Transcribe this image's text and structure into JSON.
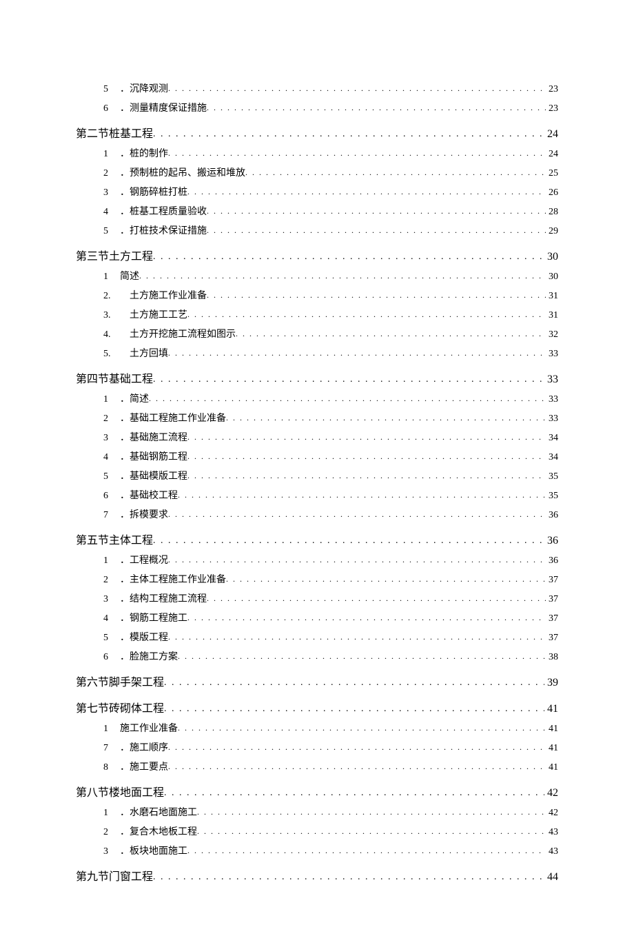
{
  "toc": [
    {
      "level": "sub",
      "num": "5",
      "label": "．沉降观测",
      "page": "23"
    },
    {
      "level": "sub",
      "num": "6",
      "label": "．测量精度保证措施",
      "page": "23"
    },
    {
      "level": "section",
      "num": "",
      "label": "第二节桩基工程",
      "page": "24"
    },
    {
      "level": "sub",
      "num": "1",
      "label": "．桩的制作",
      "page": "24"
    },
    {
      "level": "sub",
      "num": "2",
      "label": "．预制桩的起吊、搬运和堆放",
      "page": "25"
    },
    {
      "level": "sub",
      "num": "3",
      "label": "．钢筋碎桩打桩",
      "page": "26"
    },
    {
      "level": "sub",
      "num": "4",
      "label": "．桩基工程质量验收",
      "page": "28"
    },
    {
      "level": "sub",
      "num": "5",
      "label": "．打桩技术保证措施",
      "page": "29"
    },
    {
      "level": "section",
      "num": "",
      "label": "第三节土方工程",
      "page": "30"
    },
    {
      "level": "sub",
      "num": "1",
      "label": "简述",
      "page": "30"
    },
    {
      "level": "sub",
      "num": "2.",
      "label": "　土方施工作业准备",
      "page": "31"
    },
    {
      "level": "sub",
      "num": "3.",
      "label": "　土方施工工艺",
      "page": "31"
    },
    {
      "level": "sub",
      "num": "4.",
      "label": "　土方开挖施工流程如图示",
      "page": "32"
    },
    {
      "level": "sub",
      "num": "5.",
      "label": "　土方回填",
      "page": "33"
    },
    {
      "level": "section",
      "num": "",
      "label": "第四节基础工程",
      "page": "33"
    },
    {
      "level": "sub",
      "num": "1",
      "label": "．简述",
      "page": "33"
    },
    {
      "level": "sub",
      "num": "2",
      "label": "．基础工程施工作业准备",
      "page": "33"
    },
    {
      "level": "sub",
      "num": "3",
      "label": "．基础施工流程",
      "page": "34"
    },
    {
      "level": "sub",
      "num": "4",
      "label": "．基础钢筋工程",
      "page": "34"
    },
    {
      "level": "sub",
      "num": "5",
      "label": "．基础模版工程",
      "page": "35"
    },
    {
      "level": "sub",
      "num": "6",
      "label": "．基础校工程",
      "page": "35"
    },
    {
      "level": "sub",
      "num": "7",
      "label": "．拆模要求",
      "page": "36"
    },
    {
      "level": "section",
      "num": "",
      "label": "第五节主体工程",
      "page": "36"
    },
    {
      "level": "sub",
      "num": "1",
      "label": "．工程概况",
      "page": "36"
    },
    {
      "level": "sub",
      "num": "2",
      "label": "．主体工程施工作业准备",
      "page": "37"
    },
    {
      "level": "sub",
      "num": "3",
      "label": "．结构工程施工流程",
      "page": "37"
    },
    {
      "level": "sub",
      "num": "4",
      "label": "．钢筋工程施工",
      "page": "37"
    },
    {
      "level": "sub",
      "num": "5",
      "label": "．模版工程",
      "page": "37"
    },
    {
      "level": "sub",
      "num": "6",
      "label": "．脸施工方案",
      "page": "38"
    },
    {
      "level": "section",
      "num": "",
      "label": "第六节脚手架工程",
      "page": "39"
    },
    {
      "level": "section",
      "num": "",
      "label": "第七节砖砌体工程",
      "page": "41"
    },
    {
      "level": "sub",
      "num": "1",
      "label": "施工作业准备",
      "page": "41"
    },
    {
      "level": "sub",
      "num": "7",
      "label": "．施工顺序",
      "page": "41"
    },
    {
      "level": "sub",
      "num": "8",
      "label": "．施工要点",
      "page": "41"
    },
    {
      "level": "section",
      "num": "",
      "label": "第八节楼地面工程",
      "page": "42"
    },
    {
      "level": "sub",
      "num": "1",
      "label": "．水磨石地面施工",
      "page": "42"
    },
    {
      "level": "sub",
      "num": "2",
      "label": "．复合木地板工程",
      "page": "43"
    },
    {
      "level": "sub",
      "num": "3",
      "label": "．板块地面施工",
      "page": "43"
    },
    {
      "level": "section",
      "num": "",
      "label": "第九节门窗工程",
      "page": "44"
    }
  ]
}
